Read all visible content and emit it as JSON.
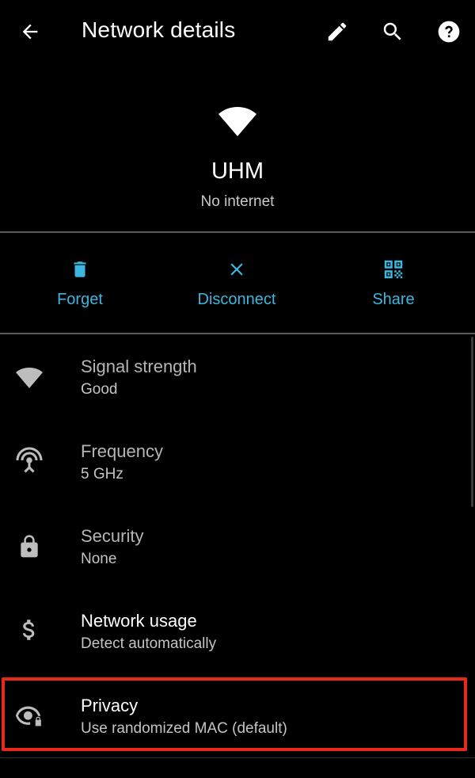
{
  "app_bar": {
    "title": "Network details",
    "back_icon": "arrow-back-icon",
    "edit_icon": "pencil-icon",
    "search_icon": "search-icon",
    "help_icon": "help-circle-icon"
  },
  "network": {
    "name": "UHM",
    "status": "No internet",
    "icon": "wifi-icon"
  },
  "actions": [
    {
      "label": "Forget",
      "icon": "trash-icon"
    },
    {
      "label": "Disconnect",
      "icon": "close-icon"
    },
    {
      "label": "Share",
      "icon": "qr-code-icon"
    }
  ],
  "details": [
    {
      "title": "Signal strength",
      "value": "Good",
      "icon": "wifi-signal-icon"
    },
    {
      "title": "Frequency",
      "value": "5 GHz",
      "icon": "antenna-icon"
    },
    {
      "title": "Security",
      "value": "None",
      "icon": "lock-icon"
    },
    {
      "title": "Network usage",
      "value": "Detect automatically",
      "icon": "dollar-icon"
    },
    {
      "title": "Privacy",
      "value": "Use randomized MAC (default)",
      "icon": "eye-lock-icon"
    }
  ],
  "colors": {
    "background": "#000000",
    "accent": "#3bb7e0",
    "highlight": "#e8281d",
    "divider": "#5b5b5b"
  }
}
